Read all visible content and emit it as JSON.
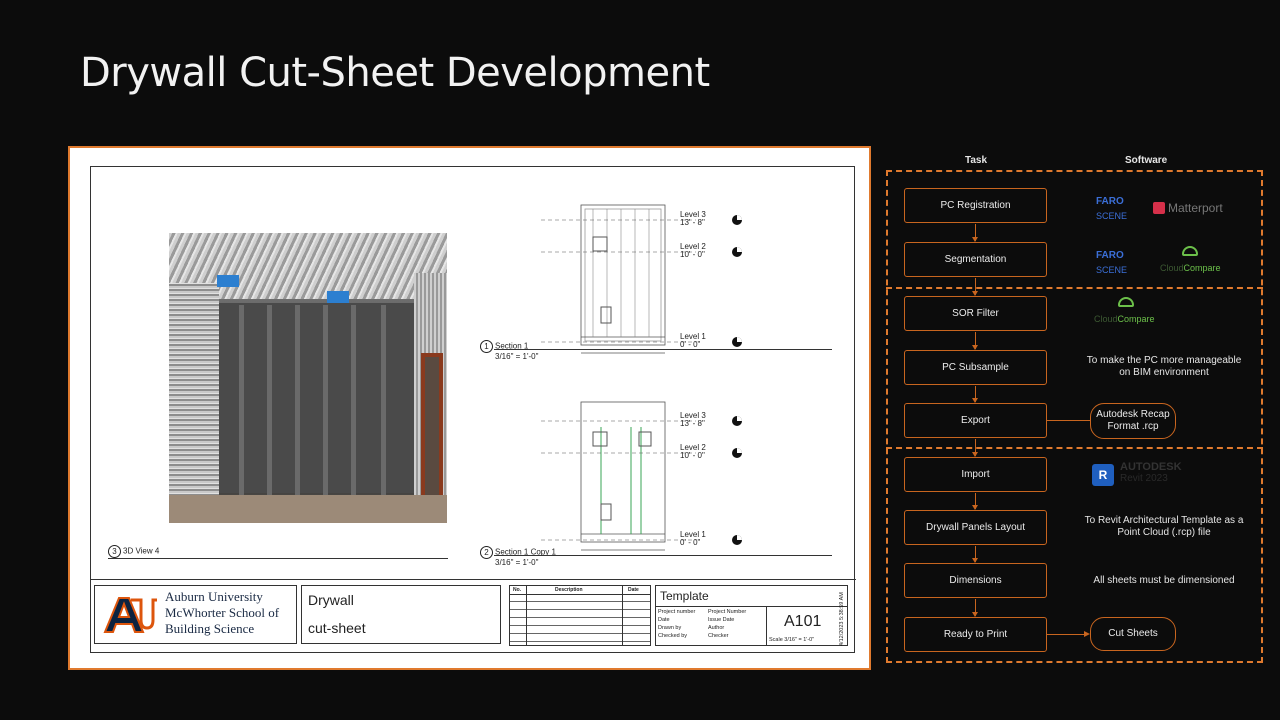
{
  "page": {
    "title": "Drywall Cut-Sheet Development"
  },
  "sheet": {
    "views": {
      "view3d": {
        "num": "3",
        "label": "3D View 4"
      },
      "section1": {
        "num": "1",
        "label": "Section 1",
        "scale": "3/16\" = 1'-0\""
      },
      "section2": {
        "num": "2",
        "label": "Section 1 Copy 1",
        "scale": "3/16\" = 1'-0\""
      }
    },
    "levels": [
      {
        "name": "Level 3",
        "elev": "13' - 8\""
      },
      {
        "name": "Level 2",
        "elev": "10' - 0\""
      },
      {
        "name": "Level 1",
        "elev": "0' - 0\""
      }
    ],
    "title_block": {
      "org_line1": "Auburn University",
      "org_line2": "McWhorter School of",
      "org_line3": "Building Science",
      "sheet_name_1": "Drywall",
      "sheet_name_2": "cut-sheet",
      "rev_headers": [
        "No.",
        "Description",
        "Date"
      ],
      "template": "Template",
      "fields": [
        {
          "k": "Project number",
          "v": "Project Number"
        },
        {
          "k": "Date",
          "v": "Issue Date"
        },
        {
          "k": "Drawn by",
          "v": "Author"
        },
        {
          "k": "Checked by",
          "v": "Checker"
        }
      ],
      "sheet_number": "A101",
      "scale": "Scale  3/16\" = 1'-0\"",
      "timestamp": "4/12/2023 5:38:59 AM"
    }
  },
  "flow": {
    "col_task": "Task",
    "col_software": "Software",
    "tasks": [
      "PC Registration",
      "Segmentation",
      "SOR Filter",
      "PC Subsample",
      "Export",
      "Import",
      "Drywall Panels Layout",
      "Dimensions",
      "Ready to Print"
    ],
    "software": {
      "faro": "FARO",
      "faro_scene": "SCENE",
      "matterport": "Matterport",
      "cloud": "Cloud",
      "compare": "Compare",
      "autodesk": "AUTODESK",
      "revit": "Revit 2023",
      "revit_letter": "R"
    },
    "notes": {
      "subsample": "To make the PC more manageable on BIM environment",
      "export_pill": "Autodesk Recap Format .rcp",
      "layout": "To Revit Architectural Template as a Point Cloud (.rcp) file",
      "dimensions": "All sheets must be dimensioned",
      "print_pill": "Cut Sheets"
    },
    "colors": {
      "accent": "#e07a2e",
      "faro": "#3b6fd8",
      "cloudcompare": "#6cc04a",
      "revit": "#1f5fbf"
    }
  }
}
